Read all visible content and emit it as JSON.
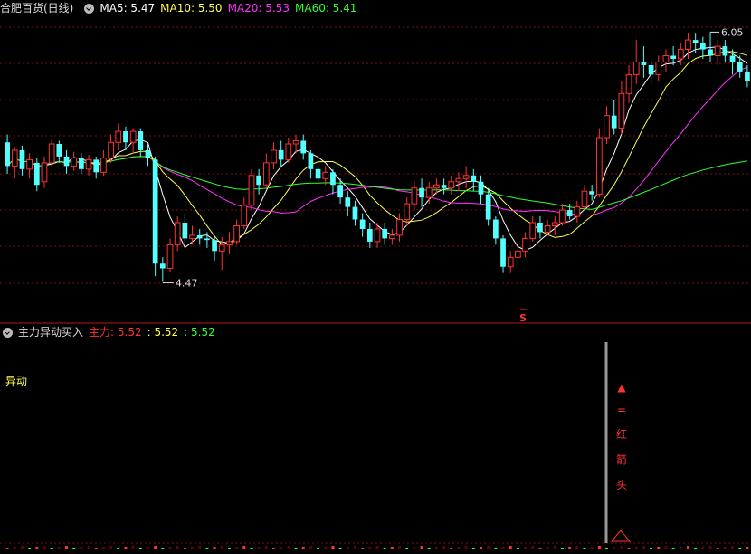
{
  "header": {
    "stock_title": "合肥百货(日线)",
    "ma5_label": "MA5: 5.47",
    "ma10_label": "MA10: 5.50",
    "ma20_label": "MA20: 5.53",
    "ma60_label": "MA60: 5.41"
  },
  "indicator": {
    "title": "主力异动买入",
    "main_label": "主力: 5.52",
    "v2": ": 5.52",
    "v3": ": 5.52",
    "yidong_label": "异动"
  },
  "annotations": {
    "low_label": "4.47",
    "high_label": "6.05",
    "s_marker": "S",
    "arrow_chars": [
      "▲",
      "=",
      "红",
      "箭",
      "头"
    ]
  },
  "colors": {
    "up": "#ff3232",
    "down": "#54ffff",
    "ma5": "#ffffff",
    "ma10": "#ffff50",
    "ma20": "#ff32ff",
    "ma60": "#32ff32"
  },
  "chart_data": {
    "type": "candlestick",
    "price_ylim": [
      4.3,
      6.15
    ],
    "candles": [
      [
        5.35,
        5.2,
        5.4,
        5.15
      ],
      [
        5.2,
        5.3,
        5.32,
        5.12
      ],
      [
        5.3,
        5.18,
        5.33,
        5.14
      ],
      [
        5.18,
        5.24,
        5.28,
        5.12
      ],
      [
        5.22,
        5.08,
        5.25,
        5.04
      ],
      [
        5.1,
        5.22,
        5.26,
        5.06
      ],
      [
        5.22,
        5.34,
        5.37,
        5.2
      ],
      [
        5.34,
        5.26,
        5.36,
        5.22
      ],
      [
        5.26,
        5.2,
        5.3,
        5.15
      ],
      [
        5.2,
        5.25,
        5.29,
        5.17
      ],
      [
        5.25,
        5.18,
        5.28,
        5.15
      ],
      [
        5.18,
        5.24,
        5.27,
        5.14
      ],
      [
        5.24,
        5.16,
        5.26,
        5.12
      ],
      [
        5.16,
        5.25,
        5.3,
        5.14
      ],
      [
        5.25,
        5.35,
        5.4,
        5.22
      ],
      [
        5.35,
        5.42,
        5.47,
        5.3
      ],
      [
        5.42,
        5.35,
        5.45,
        5.3
      ],
      [
        5.35,
        5.42,
        5.44,
        5.28
      ],
      [
        5.42,
        5.3,
        5.44,
        5.26
      ],
      [
        5.3,
        5.25,
        5.34,
        5.2
      ],
      [
        5.24,
        4.58,
        5.26,
        4.5
      ],
      [
        4.58,
        4.55,
        4.62,
        4.47
      ],
      [
        4.55,
        4.7,
        4.74,
        4.53
      ],
      [
        4.7,
        4.84,
        4.88,
        4.66
      ],
      [
        4.84,
        4.74,
        4.9,
        4.7
      ],
      [
        4.74,
        4.76,
        4.82,
        4.7
      ],
      [
        4.76,
        4.74,
        4.8,
        4.7
      ],
      [
        4.74,
        4.73,
        4.78,
        4.68
      ],
      [
        4.73,
        4.66,
        4.76,
        4.6
      ],
      [
        4.66,
        4.7,
        4.75,
        4.54
      ],
      [
        4.7,
        4.72,
        4.78,
        4.64
      ],
      [
        4.72,
        4.82,
        4.86,
        4.7
      ],
      [
        4.82,
        4.95,
        5.0,
        4.8
      ],
      [
        4.95,
        5.14,
        5.18,
        4.92
      ],
      [
        5.14,
        5.08,
        5.18,
        5.02
      ],
      [
        5.08,
        5.22,
        5.28,
        5.05
      ],
      [
        5.22,
        5.3,
        5.35,
        5.18
      ],
      [
        5.3,
        5.24,
        5.36,
        5.2
      ],
      [
        5.24,
        5.34,
        5.38,
        5.22
      ],
      [
        5.34,
        5.36,
        5.4,
        5.28
      ],
      [
        5.36,
        5.28,
        5.4,
        5.24
      ],
      [
        5.28,
        5.18,
        5.3,
        5.12
      ],
      [
        5.18,
        5.12,
        5.22,
        5.08
      ],
      [
        5.12,
        5.16,
        5.2,
        5.08
      ],
      [
        5.16,
        5.08,
        5.18,
        5.02
      ],
      [
        5.08,
        5.0,
        5.12,
        4.96
      ],
      [
        5.0,
        4.94,
        5.04,
        4.88
      ],
      [
        4.94,
        4.86,
        4.98,
        4.82
      ],
      [
        4.86,
        4.8,
        4.9,
        4.75
      ],
      [
        4.8,
        4.72,
        4.84,
        4.68
      ],
      [
        4.72,
        4.8,
        4.84,
        4.68
      ],
      [
        4.8,
        4.74,
        4.84,
        4.7
      ],
      [
        4.74,
        4.76,
        4.8,
        4.7
      ],
      [
        4.76,
        4.86,
        4.9,
        4.72
      ],
      [
        4.86,
        4.96,
        5.0,
        4.82
      ],
      [
        4.96,
        5.06,
        5.1,
        4.92
      ],
      [
        5.06,
        5.0,
        5.12,
        4.94
      ],
      [
        5.0,
        5.06,
        5.1,
        4.96
      ],
      [
        5.06,
        5.08,
        5.12,
        5.02
      ],
      [
        5.08,
        5.06,
        5.12,
        5.02
      ],
      [
        5.06,
        5.1,
        5.14,
        5.02
      ],
      [
        5.1,
        5.12,
        5.16,
        5.04
      ],
      [
        5.12,
        5.14,
        5.2,
        5.06
      ],
      [
        5.14,
        5.1,
        5.18,
        5.04
      ],
      [
        5.1,
        5.02,
        5.14,
        4.96
      ],
      [
        5.02,
        4.86,
        5.06,
        4.82
      ],
      [
        4.86,
        4.74,
        4.88,
        4.7
      ],
      [
        4.74,
        4.56,
        4.76,
        4.52
      ],
      [
        4.56,
        4.62,
        4.66,
        4.52
      ],
      [
        4.62,
        4.66,
        4.7,
        4.58
      ],
      [
        4.66,
        4.74,
        4.78,
        4.62
      ],
      [
        4.74,
        4.84,
        4.88,
        4.72
      ],
      [
        4.84,
        4.78,
        4.88,
        4.74
      ],
      [
        4.78,
        4.82,
        4.86,
        4.76
      ],
      [
        4.82,
        4.84,
        4.88,
        4.76
      ],
      [
        4.84,
        4.92,
        4.96,
        4.82
      ],
      [
        4.92,
        4.88,
        4.96,
        4.86
      ],
      [
        4.88,
        4.94,
        4.98,
        4.84
      ],
      [
        4.94,
        5.04,
        5.08,
        4.92
      ],
      [
        5.04,
        5.02,
        5.08,
        4.98
      ],
      [
        5.02,
        5.38,
        5.44,
        5.0
      ],
      [
        5.38,
        5.52,
        5.58,
        5.34
      ],
      [
        5.52,
        5.44,
        5.62,
        5.4
      ],
      [
        5.44,
        5.66,
        5.74,
        5.4
      ],
      [
        5.66,
        5.78,
        5.84,
        5.6
      ],
      [
        5.78,
        5.86,
        6.0,
        5.72
      ],
      [
        5.86,
        5.84,
        5.96,
        5.76
      ],
      [
        5.84,
        5.78,
        5.88,
        5.72
      ],
      [
        5.78,
        5.86,
        5.9,
        5.74
      ],
      [
        5.86,
        5.9,
        5.94,
        5.8
      ],
      [
        5.9,
        5.88,
        5.96,
        5.84
      ],
      [
        5.88,
        5.94,
        5.98,
        5.84
      ],
      [
        5.94,
        6.0,
        6.04,
        5.88
      ],
      [
        6.0,
        5.98,
        6.04,
        5.92
      ],
      [
        5.98,
        5.94,
        6.02,
        5.88
      ],
      [
        5.94,
        5.9,
        6.05,
        5.86
      ],
      [
        5.9,
        5.96,
        6.0,
        5.84
      ],
      [
        5.96,
        5.9,
        6.0,
        5.86
      ],
      [
        5.9,
        5.86,
        5.94,
        5.78
      ],
      [
        5.86,
        5.8,
        5.9,
        5.76
      ],
      [
        5.8,
        5.74,
        5.84,
        5.7
      ]
    ],
    "ma_series": [
      {
        "name": "MA5",
        "period": 5
      },
      {
        "name": "MA10",
        "period": 10
      },
      {
        "name": "MA20",
        "period": 20
      },
      {
        "name": "MA60",
        "period": 60
      }
    ]
  }
}
